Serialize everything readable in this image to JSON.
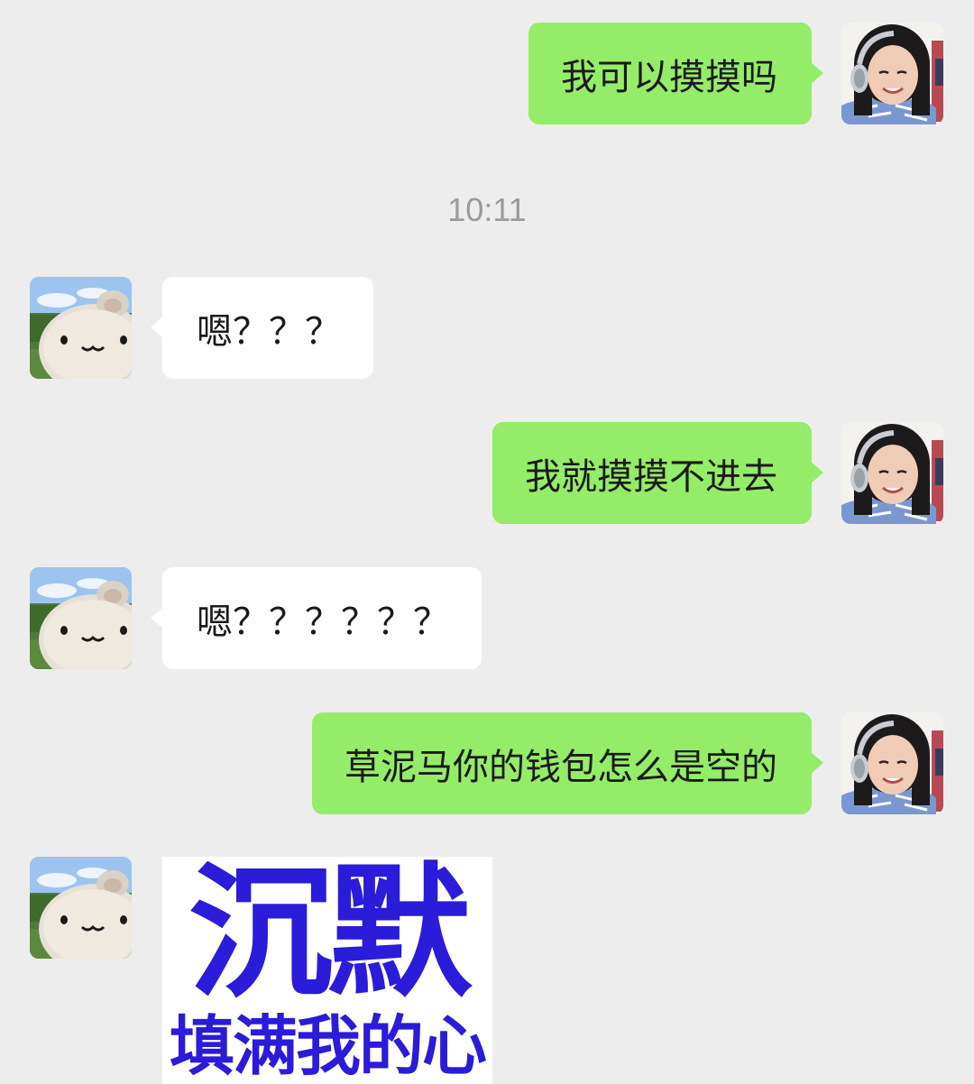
{
  "messages": [
    {
      "side": "right",
      "text": "我可以摸摸吗"
    },
    {
      "side": "left",
      "text": "嗯？？？"
    },
    {
      "side": "right",
      "text": "我就摸摸不进去"
    },
    {
      "side": "left",
      "text": "嗯？？？？？？"
    },
    {
      "side": "right",
      "text": "草泥马你的钱包怎么是空的"
    }
  ],
  "timestamp": "10:11",
  "sticker": {
    "line1": "沉默",
    "line2": "填满我的心"
  },
  "avatars": {
    "self": "girl-with-headphones-avatar",
    "contact": "white-creature-in-field-avatar"
  },
  "colors": {
    "background": "#ededed",
    "self_bubble": "#95ec69",
    "contact_bubble": "#ffffff",
    "sticker_text": "#2a1cd8",
    "timestamp": "#9a9a9a"
  }
}
